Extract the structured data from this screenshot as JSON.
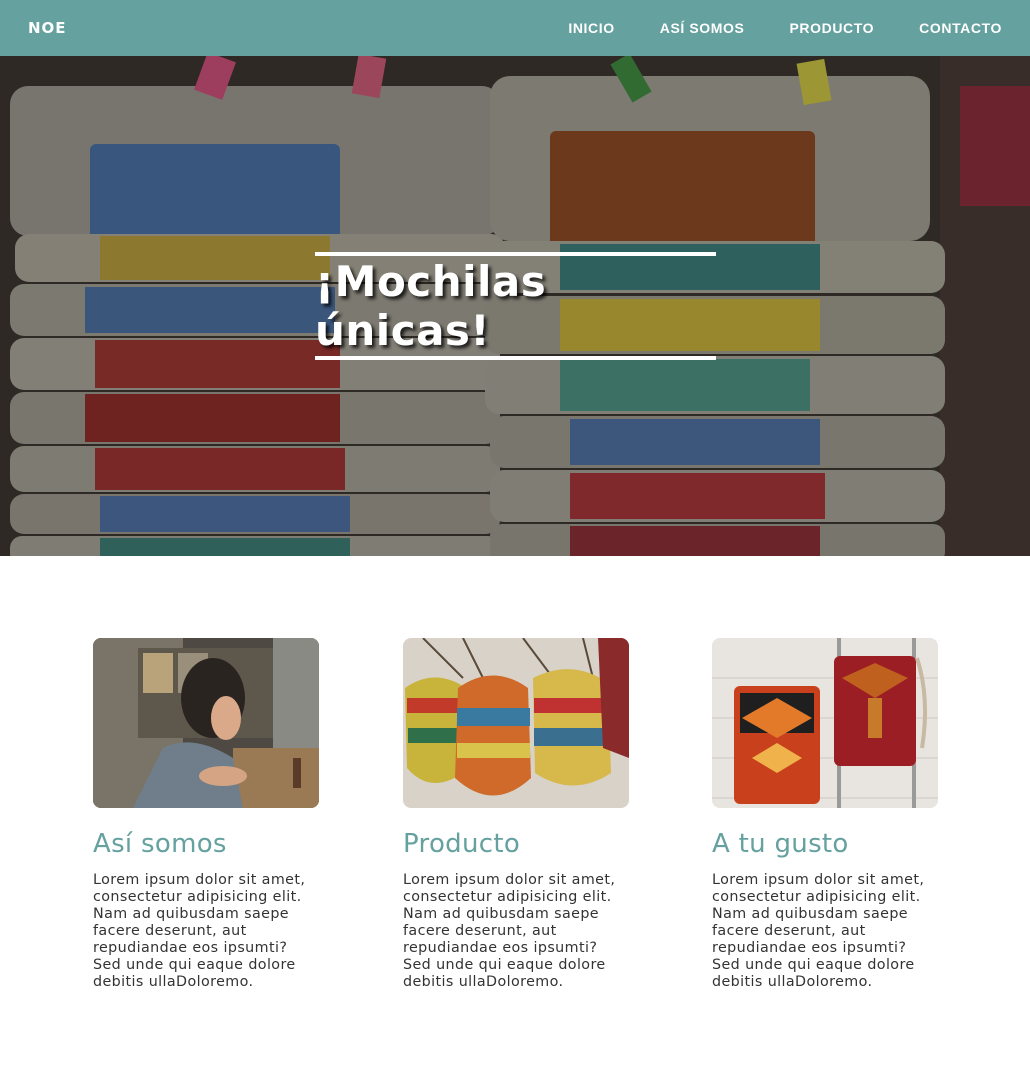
{
  "nav": {
    "logo": "NOE",
    "links": [
      "INICIO",
      "ASÍ SOMOS",
      "PRODUCTO",
      "CONTACTO"
    ]
  },
  "hero": {
    "title": "¡Mochilas únicas!"
  },
  "cards": [
    {
      "title": "Así somos",
      "text": "Lorem ipsum dolor sit amet, consectetur adipisicing elit. Nam ad quibusdam saepe facere deserunt, aut repudiandae eos ipsumti? Sed unde qui eaque dolore debitis ullaDoloremo."
    },
    {
      "title": "Producto",
      "text": "Lorem ipsum dolor sit amet, consectetur adipisicing elit. Nam ad quibusdam saepe facere deserunt, aut repudiandae eos ipsumti? Sed unde qui eaque dolore debitis ullaDoloremo."
    },
    {
      "title": "A tu gusto",
      "text": "Lorem ipsum dolor sit amet, consectetur adipisicing elit. Nam ad quibusdam saepe facere deserunt, aut repudiandae eos ipsumti? Sed unde qui eaque dolore debitis ullaDoloremo."
    }
  ],
  "colors": {
    "brand": "#65a19f",
    "text": "#333333",
    "background": "#ffffff"
  },
  "images": {
    "hero": "stacked-backpacks-photo",
    "card_1": "artisan-working-photo",
    "card_2": "woven-bags-photo",
    "card_3": "patterned-backpacks-photo"
  }
}
